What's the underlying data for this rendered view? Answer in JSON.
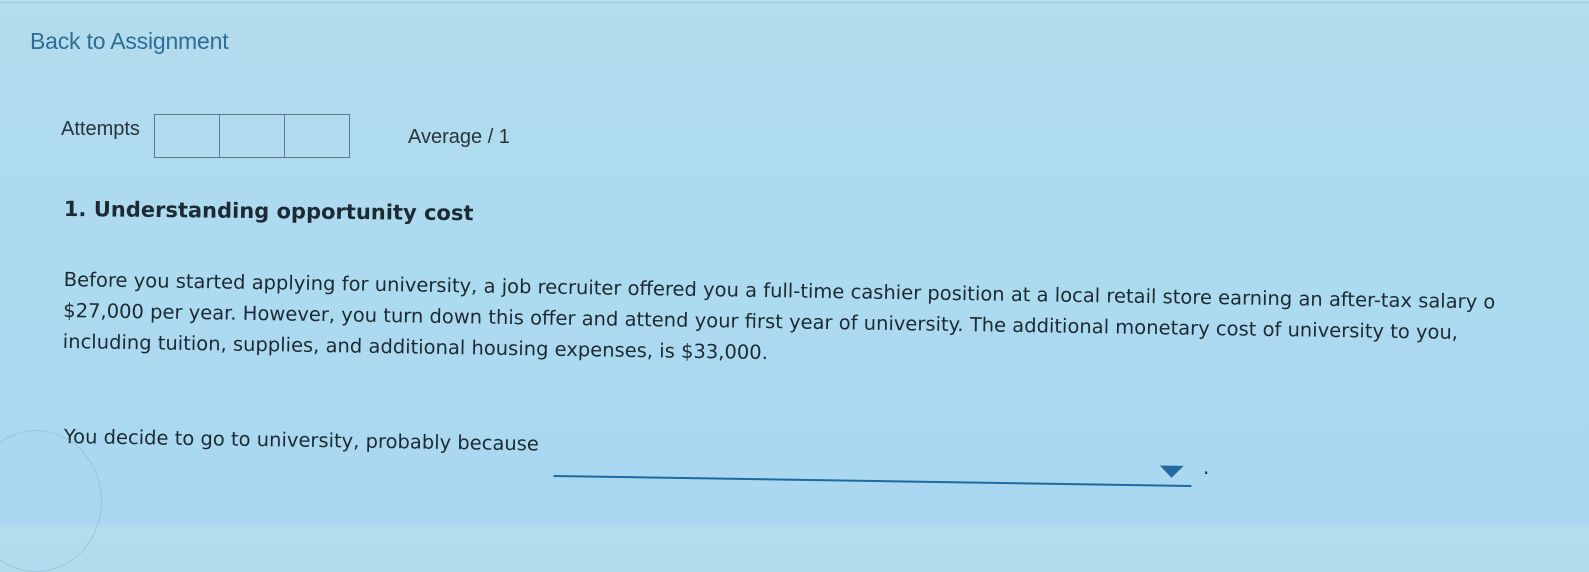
{
  "nav": {
    "back_label": "Back to Assignment"
  },
  "attempts": {
    "label": "Attempts",
    "boxes": 3,
    "average_label": "Average / 1"
  },
  "question": {
    "title": "1. Understanding opportunity cost",
    "passage_lines": [
      "Before you started applying for university, a job recruiter offered you a full-time cashier position at a local retail store earning an after-tax salary o",
      "$27,000 per year. However, you turn down this offer and attend your first year of university. The additional monetary cost of university to you,",
      "including tuition, supplies, and additional housing expenses, is $33,000."
    ],
    "prompt": "You decide to go to university, probably because",
    "dropdown": {
      "selected_value": "",
      "caret_icon": "caret-down-icon"
    },
    "trailing_punctuation": "."
  },
  "colors": {
    "link": "#2d6e95",
    "accent": "#1f6a9e",
    "background": "#addaef"
  }
}
